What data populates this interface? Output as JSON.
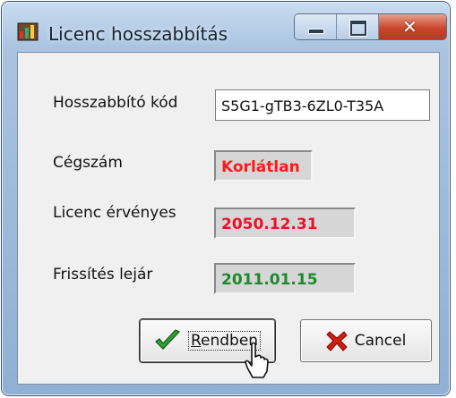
{
  "window": {
    "title": "Licenc hosszabbítás"
  },
  "form": {
    "renewal_code": {
      "label": "Hosszabbító kód",
      "value": "S5G1-gTB3-6ZL0-T35A"
    },
    "company_count": {
      "label": "Cégszám",
      "value": "Korlátlan",
      "color": "#ff1a1a"
    },
    "license_valid": {
      "label": "Licenc érvényes",
      "value": "2050.12.31",
      "color": "#e8132a"
    },
    "update_expires": {
      "label": "Frissítés lejár",
      "value": "2011.01.15",
      "color": "#1c8a2a"
    }
  },
  "buttons": {
    "ok": {
      "label": "Rendben",
      "mnemonic": "R",
      "icon": "checkmark-icon"
    },
    "cancel": {
      "label": "Cancel",
      "icon": "red-x-icon"
    }
  }
}
